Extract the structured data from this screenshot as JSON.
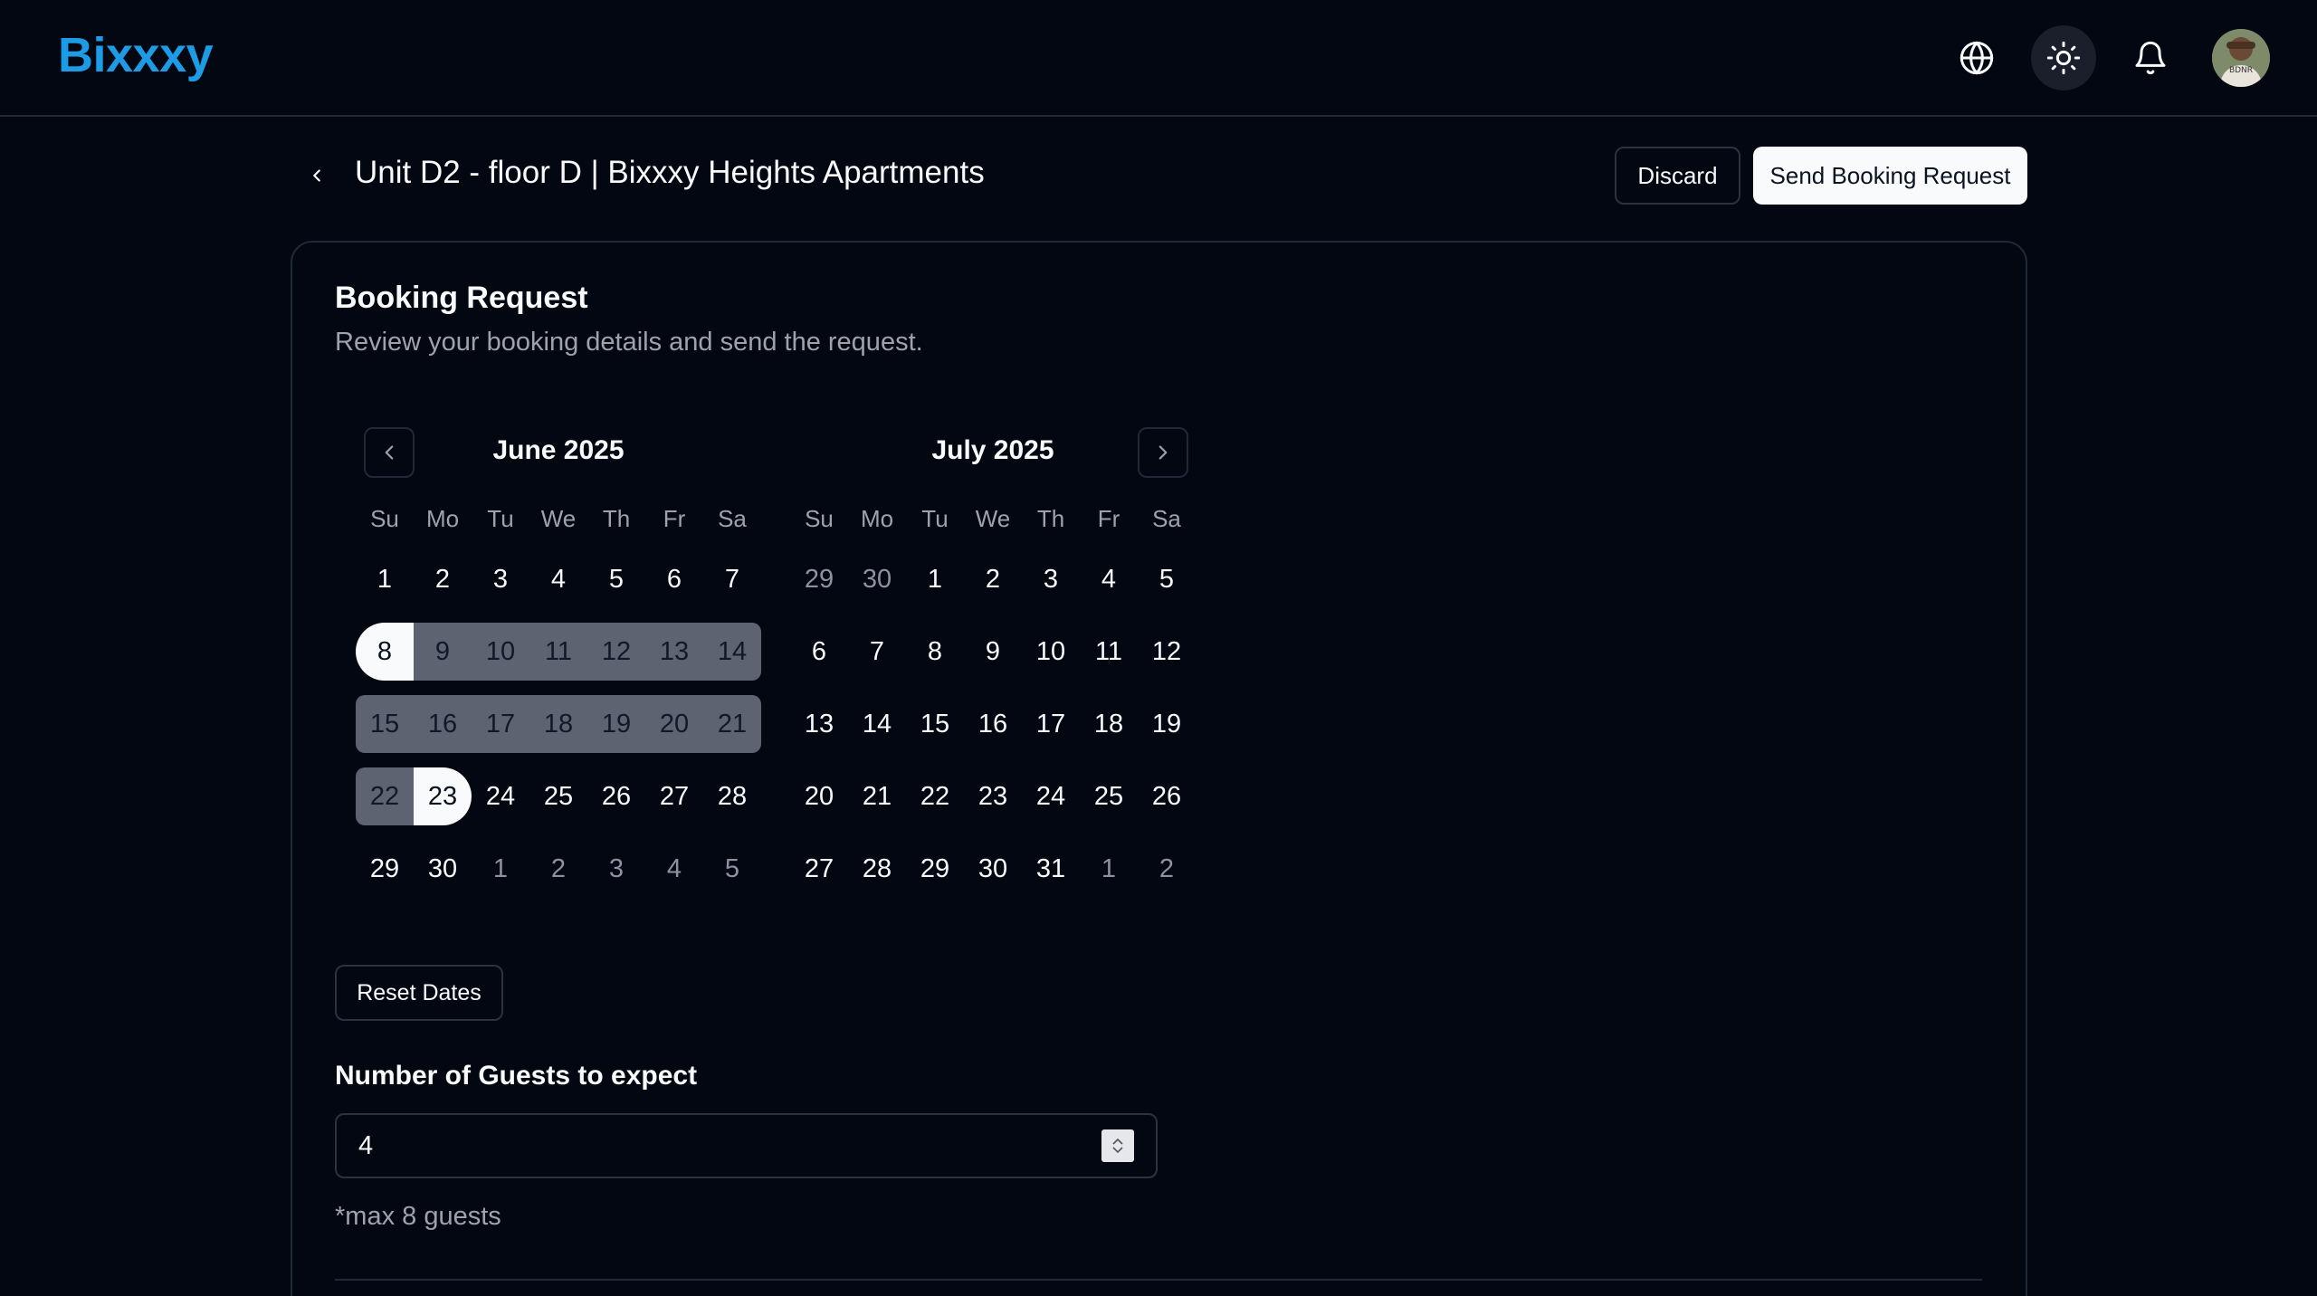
{
  "app": {
    "name": "Bixxxy"
  },
  "topbar": {
    "icons": [
      "globe-icon",
      "sun-icon",
      "bell-icon"
    ],
    "avatar_text": "BDNR"
  },
  "header": {
    "title": "Unit D2 - floor D | Bixxxy Heights Apartments",
    "discard_label": "Discard",
    "send_label": "Send Booking Request"
  },
  "booking": {
    "title": "Booking Request",
    "subtitle": "Review your booking details and send the request.",
    "reset_label": "Reset Dates",
    "guests_label": "Number of Guests to expect",
    "guests_value": "4",
    "guests_note": "*max 8 guests"
  },
  "calendar": {
    "weekdays": [
      "Su",
      "Mo",
      "Tu",
      "We",
      "Th",
      "Fr",
      "Sa"
    ],
    "months": [
      {
        "label": "June 2025",
        "weeks": [
          [
            {
              "d": "1"
            },
            {
              "d": "2"
            },
            {
              "d": "3"
            },
            {
              "d": "4"
            },
            {
              "d": "5"
            },
            {
              "d": "6"
            },
            {
              "d": "7"
            }
          ],
          [
            {
              "d": "8",
              "s": "start"
            },
            {
              "d": "9",
              "s": "range"
            },
            {
              "d": "10",
              "s": "range"
            },
            {
              "d": "11",
              "s": "range"
            },
            {
              "d": "12",
              "s": "range"
            },
            {
              "d": "13",
              "s": "range"
            },
            {
              "d": "14",
              "s": "range"
            }
          ],
          [
            {
              "d": "15",
              "s": "range"
            },
            {
              "d": "16",
              "s": "range"
            },
            {
              "d": "17",
              "s": "range"
            },
            {
              "d": "18",
              "s": "range"
            },
            {
              "d": "19",
              "s": "range"
            },
            {
              "d": "20",
              "s": "range"
            },
            {
              "d": "21",
              "s": "range"
            }
          ],
          [
            {
              "d": "22",
              "s": "range"
            },
            {
              "d": "23",
              "s": "end"
            },
            {
              "d": "24"
            },
            {
              "d": "25"
            },
            {
              "d": "26"
            },
            {
              "d": "27"
            },
            {
              "d": "28"
            }
          ],
          [
            {
              "d": "29"
            },
            {
              "d": "30"
            },
            {
              "d": "1",
              "s": "muted"
            },
            {
              "d": "2",
              "s": "muted"
            },
            {
              "d": "3",
              "s": "muted"
            },
            {
              "d": "4",
              "s": "muted"
            },
            {
              "d": "5",
              "s": "muted"
            }
          ]
        ]
      },
      {
        "label": "July 2025",
        "weeks": [
          [
            {
              "d": "29",
              "s": "muted"
            },
            {
              "d": "30",
              "s": "muted"
            },
            {
              "d": "1"
            },
            {
              "d": "2"
            },
            {
              "d": "3"
            },
            {
              "d": "4"
            },
            {
              "d": "5"
            }
          ],
          [
            {
              "d": "6"
            },
            {
              "d": "7"
            },
            {
              "d": "8"
            },
            {
              "d": "9"
            },
            {
              "d": "10"
            },
            {
              "d": "11"
            },
            {
              "d": "12"
            }
          ],
          [
            {
              "d": "13"
            },
            {
              "d": "14"
            },
            {
              "d": "15"
            },
            {
              "d": "16"
            },
            {
              "d": "17"
            },
            {
              "d": "18"
            },
            {
              "d": "19"
            }
          ],
          [
            {
              "d": "20"
            },
            {
              "d": "21"
            },
            {
              "d": "22"
            },
            {
              "d": "23"
            },
            {
              "d": "24"
            },
            {
              "d": "25"
            },
            {
              "d": "26"
            }
          ],
          [
            {
              "d": "27"
            },
            {
              "d": "28"
            },
            {
              "d": "29"
            },
            {
              "d": "30"
            },
            {
              "d": "31"
            },
            {
              "d": "1",
              "s": "muted"
            },
            {
              "d": "2",
              "s": "muted"
            }
          ]
        ]
      }
    ]
  },
  "colors": {
    "brand": "#1d9be5",
    "background": "#030712",
    "range": "#5d6371",
    "selected": "#f8fafc"
  }
}
